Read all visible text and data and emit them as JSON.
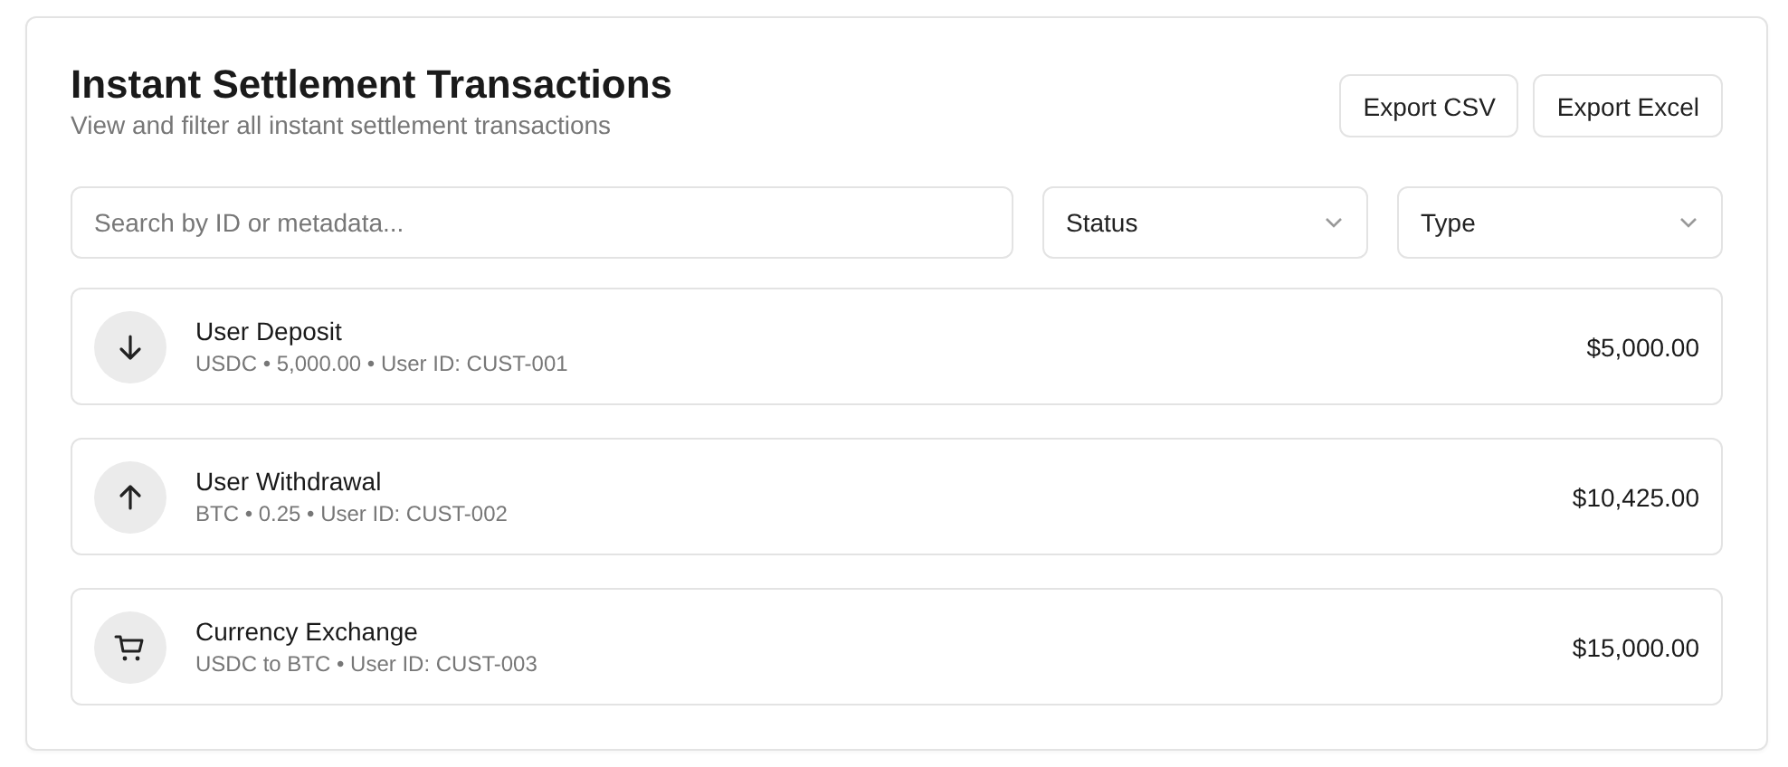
{
  "header": {
    "title": "Instant Settlement Transactions",
    "subtitle": "View and filter all instant settlement transactions"
  },
  "actions": [
    "Export CSV",
    "Export Excel"
  ],
  "search": {
    "placeholder": "Search by ID or metadata..."
  },
  "filters": [
    {
      "label": "Status"
    },
    {
      "label": "Type"
    }
  ],
  "transactions": [
    {
      "kind": "deposit",
      "title": "User Deposit",
      "details": "USDC • 5,000.00 • User ID: CUST-001",
      "amount": "$5,000.00"
    },
    {
      "kind": "withdrawal",
      "title": "User Withdrawal",
      "details": "BTC • 0.25 • User ID: CUST-002",
      "amount": "$10,425.00"
    },
    {
      "kind": "exchange",
      "title": "Currency Exchange",
      "details": "USDC to BTC • User ID: CUST-003",
      "amount": "$15,000.00"
    }
  ]
}
